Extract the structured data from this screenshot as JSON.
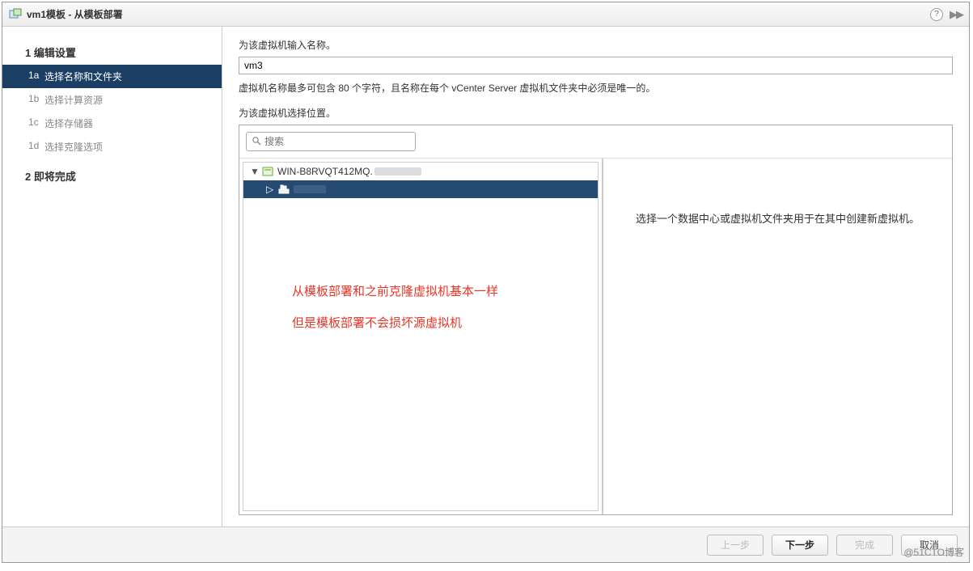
{
  "title": "vm1模板 - 从模板部署",
  "sidebar": {
    "step1": {
      "num": "1",
      "label": "编辑设置"
    },
    "sub": {
      "a": {
        "num": "1a",
        "label": "选择名称和文件夹"
      },
      "b": {
        "num": "1b",
        "label": "选择计算资源"
      },
      "c": {
        "num": "1c",
        "label": "选择存储器"
      },
      "d": {
        "num": "1d",
        "label": "选择克隆选项"
      }
    },
    "step2": {
      "num": "2",
      "label": "即将完成"
    }
  },
  "main": {
    "prompt_name": "为该虚拟机输入名称。",
    "vm_name_value": "vm3",
    "hint": "虚拟机名称最多可包含 80 个字符，且名称在每个 vCenter Server 虚拟机文件夹中必须是唯一的。",
    "prompt_location": "为该虚拟机选择位置。",
    "search_placeholder": "搜索",
    "tree": {
      "root": "WIN-B8RVQT412MQ.",
      "child": ""
    },
    "annotation_line1": "从模板部署和之前克隆虚拟机基本一样",
    "annotation_line2": "但是模板部署不会损坏源虚拟机",
    "info_text": "选择一个数据中心或虚拟机文件夹用于在其中创建新虚拟机。"
  },
  "footer": {
    "back": "上一步",
    "next": "下一步",
    "finish": "完成",
    "cancel": "取消"
  },
  "watermark": "@51CTO博客"
}
